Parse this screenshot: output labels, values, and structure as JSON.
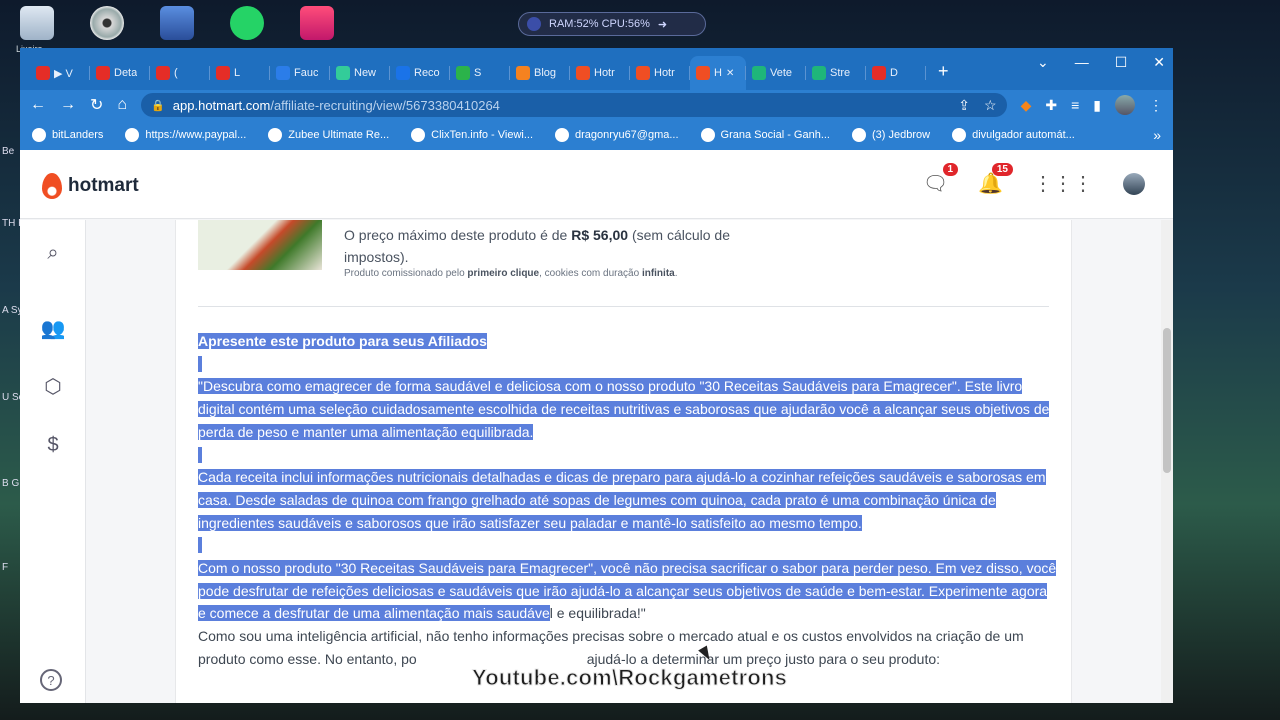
{
  "desktop": {
    "icon_label": "Lixeira",
    "perf_widget": "RAM:52% CPU:56%",
    "side_labels": [
      "Be",
      "TH FIG",
      "A Sy",
      "U Sc",
      "B G",
      "F"
    ]
  },
  "browser": {
    "tabs": [
      {
        "label": "▶ V",
        "color": "#e52d27"
      },
      {
        "label": "Deta",
        "color": "#e52d27"
      },
      {
        "label": "(",
        "color": "#e52d27"
      },
      {
        "label": "L",
        "color": "#e52d27"
      },
      {
        "label": "Fauc",
        "color": "#2b7de9"
      },
      {
        "label": "New",
        "color": "#3c9"
      },
      {
        "label": "Reco",
        "color": "#1a73e8"
      },
      {
        "label": "S",
        "color": "#2bb34a"
      },
      {
        "label": "Blog",
        "color": "#f58220"
      },
      {
        "label": "Hotr",
        "color": "#f04e23"
      },
      {
        "label": "Hotr",
        "color": "#f04e23"
      },
      {
        "label": "H",
        "color": "#f04e23"
      },
      {
        "label": "Vete",
        "color": "#1fb67a"
      },
      {
        "label": "Stre",
        "color": "#1fb67a"
      },
      {
        "label": "D",
        "color": "#e52d27"
      }
    ],
    "active_tab_index": 11,
    "url_host": "app.hotmart.com",
    "url_path": "/affiliate-recruiting/view/5673380410264",
    "bookmarks": [
      "bitLanders",
      "https://www.paypal...",
      "Zubee Ultimate Re...",
      "ClixTen.info - Viewi...",
      "dragonryu67@gma...",
      "Grana Social - Ganh...",
      "(3) Jedbrow",
      "divulgador automát..."
    ]
  },
  "hotmart": {
    "logo": "hotmart",
    "chat_badge": "1",
    "bell_badge": "15"
  },
  "product": {
    "price_prefix": "O preço máximo deste produto é de ",
    "price_value": "R$ 56,00",
    "price_suffix": " (sem cálculo de impostos).",
    "note_prefix": "Produto comissionado pelo ",
    "note_bold1": "primeiro clique",
    "note_mid": ", cookies com duração ",
    "note_bold2": "infinita",
    "note_end": "."
  },
  "article": {
    "heading": "Apresente este produto para seus Afiliados",
    "p1": "\"Descubra como emagrecer de forma saudável e deliciosa com o nosso produto \"30 Receitas Saudáveis para Emagrecer\". Este livro digital contém uma seleção cuidadosamente escolhida de receitas nutritivas e saborosas que ajudarão você a alcançar seus objetivos de perda de peso e manter uma alimentação equilibrada.",
    "p2": "Cada receita inclui informações nutricionais detalhadas e dicas de preparo para ajudá-lo a cozinhar refeições saudáveis e saborosas em casa. Desde saladas de quinoa com frango grelhado até sopas de legumes com quinoa, cada prato é uma combinação única de ingredientes saudáveis e saborosos que irão satisfazer seu paladar e mantê-lo satisfeito ao mesmo tempo.",
    "p3_selected": "Com o nosso produto \"30 Receitas Saudáveis para Emagrecer\", você não precisa sacrificar o sabor para perder peso. Em vez disso, você pode desfrutar de refeições deliciosas e saudáveis que irão ajudá-lo a alcançar seus objetivos de saúde e bem-estar. Experimente agora e comece a desfrutar de uma alimentação mais saudáve",
    "p3_rest": "l e equilibrada!\"",
    "p4_start": "Como sou uma inteligência artificial, não tenho informações precisas sobre o mercado atual e os custos envolvidos na criação de um produto como esse. No entanto, po",
    "p4_end": "ajudá-lo a determinar um preço justo para o seu produto:"
  },
  "overlay": {
    "watermark": "Youtube.com\\Rockgametrons"
  }
}
